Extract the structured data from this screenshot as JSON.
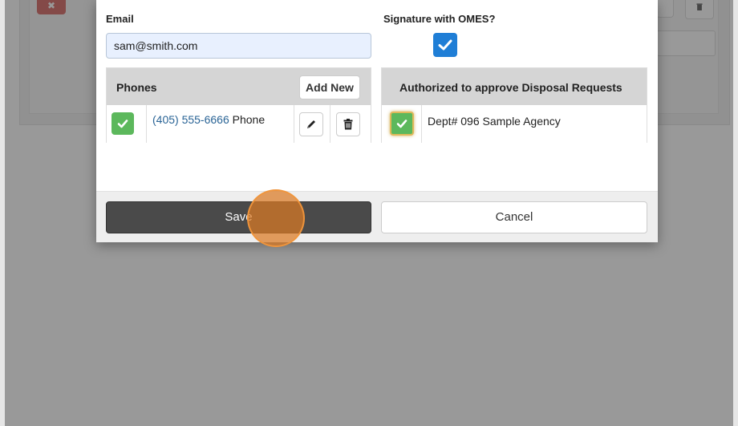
{
  "background": {
    "left_button_icon": "close-icon",
    "right_button_icon": "trash-icon"
  },
  "modal": {
    "email": {
      "label": "Email",
      "value": "sam@smith.com"
    },
    "signature": {
      "label": "Signature with OMES?",
      "checked": true
    },
    "phones": {
      "header": "Phones",
      "add_new_label": "Add New",
      "rows": [
        {
          "checked": true,
          "number": "(405) 555-6666",
          "type": "Phone",
          "edit_icon": "pencil-icon",
          "delete_icon": "trash-icon"
        }
      ]
    },
    "authorized": {
      "header": "Authorized to approve Disposal Requests",
      "rows": [
        {
          "checked": true,
          "label": "Dept# 096 Sample Agency"
        }
      ]
    },
    "footer": {
      "save_label": "Save",
      "cancel_label": "Cancel"
    }
  },
  "colors": {
    "accent_blue": "#1f7ed6",
    "success_green": "#5cb85c",
    "save_button": "#4a4a4a",
    "click_indicator": "#db7a24"
  }
}
